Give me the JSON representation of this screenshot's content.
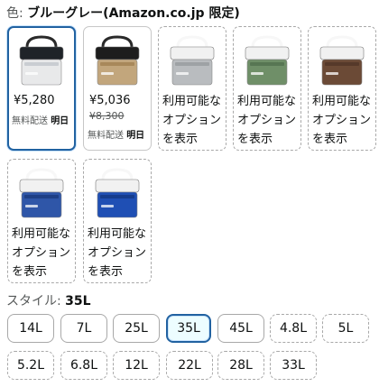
{
  "color": {
    "label": "色: ",
    "value": "ブルーグレー(Amazon.co.jp 限定)"
  },
  "swatches": [
    {
      "name": "blue-gray",
      "price": "¥5,280",
      "strike": "",
      "delivery_prefix": "無料配送",
      "delivery_day": "明日",
      "body": "#e8e9ea",
      "lid": "#1f2328",
      "handle": "#2a2a2a",
      "accent": "#c9cdd2",
      "state": "selected"
    },
    {
      "name": "khaki",
      "price": "¥5,036",
      "strike": "¥8,300",
      "delivery_prefix": "無料配送",
      "delivery_day": "明日",
      "body": "#c2a67c",
      "lid": "#1d1d1d",
      "handle": "#2a2a2a",
      "accent": "#a8885a",
      "state": "available"
    },
    {
      "name": "light-gray",
      "unavailable_text": "利用可能なオプションを表示",
      "body": "#b9bcbf",
      "lid": "#f1f1f1",
      "handle": "#f7f7f7",
      "accent": "#9ea2a5",
      "state": "unavailable"
    },
    {
      "name": "green",
      "unavailable_text": "利用可能なオプションを表示",
      "body": "#6f8f68",
      "lid": "#f1f1f1",
      "handle": "#f7f7f7",
      "accent": "#577653",
      "state": "unavailable"
    },
    {
      "name": "brown",
      "unavailable_text": "利用可能なオプションを表示",
      "body": "#6b4a36",
      "lid": "#f1f1f1",
      "handle": "#f7f7f7",
      "accent": "#56392a",
      "state": "unavailable"
    },
    {
      "name": "blue",
      "unavailable_text": "利用可能なオプションを表示",
      "body": "#2f56a8",
      "lid": "#f1f1f1",
      "handle": "#f7f7f7",
      "accent": "#1f3f85",
      "state": "unavailable"
    },
    {
      "name": "royal-blue",
      "unavailable_text": "利用可能なオプションを表示",
      "body": "#1f4fb4",
      "lid": "#f1f1f1",
      "handle": "#f7f7f7",
      "accent": "#163c8c",
      "state": "unavailable"
    }
  ],
  "style": {
    "label": "スタイル: ",
    "value": "35L"
  },
  "sizes": [
    {
      "label": "14L",
      "state": "available"
    },
    {
      "label": "7L",
      "state": "available"
    },
    {
      "label": "25L",
      "state": "available"
    },
    {
      "label": "35L",
      "state": "selected"
    },
    {
      "label": "45L",
      "state": "available"
    },
    {
      "label": "4.8L",
      "state": "unavailable"
    },
    {
      "label": "5L",
      "state": "unavailable"
    },
    {
      "label": "5.2L",
      "state": "unavailable"
    },
    {
      "label": "6.8L",
      "state": "unavailable"
    },
    {
      "label": "12L",
      "state": "unavailable"
    },
    {
      "label": "22L",
      "state": "unavailable"
    },
    {
      "label": "28L",
      "state": "unavailable"
    },
    {
      "label": "33L",
      "state": "unavailable"
    }
  ]
}
